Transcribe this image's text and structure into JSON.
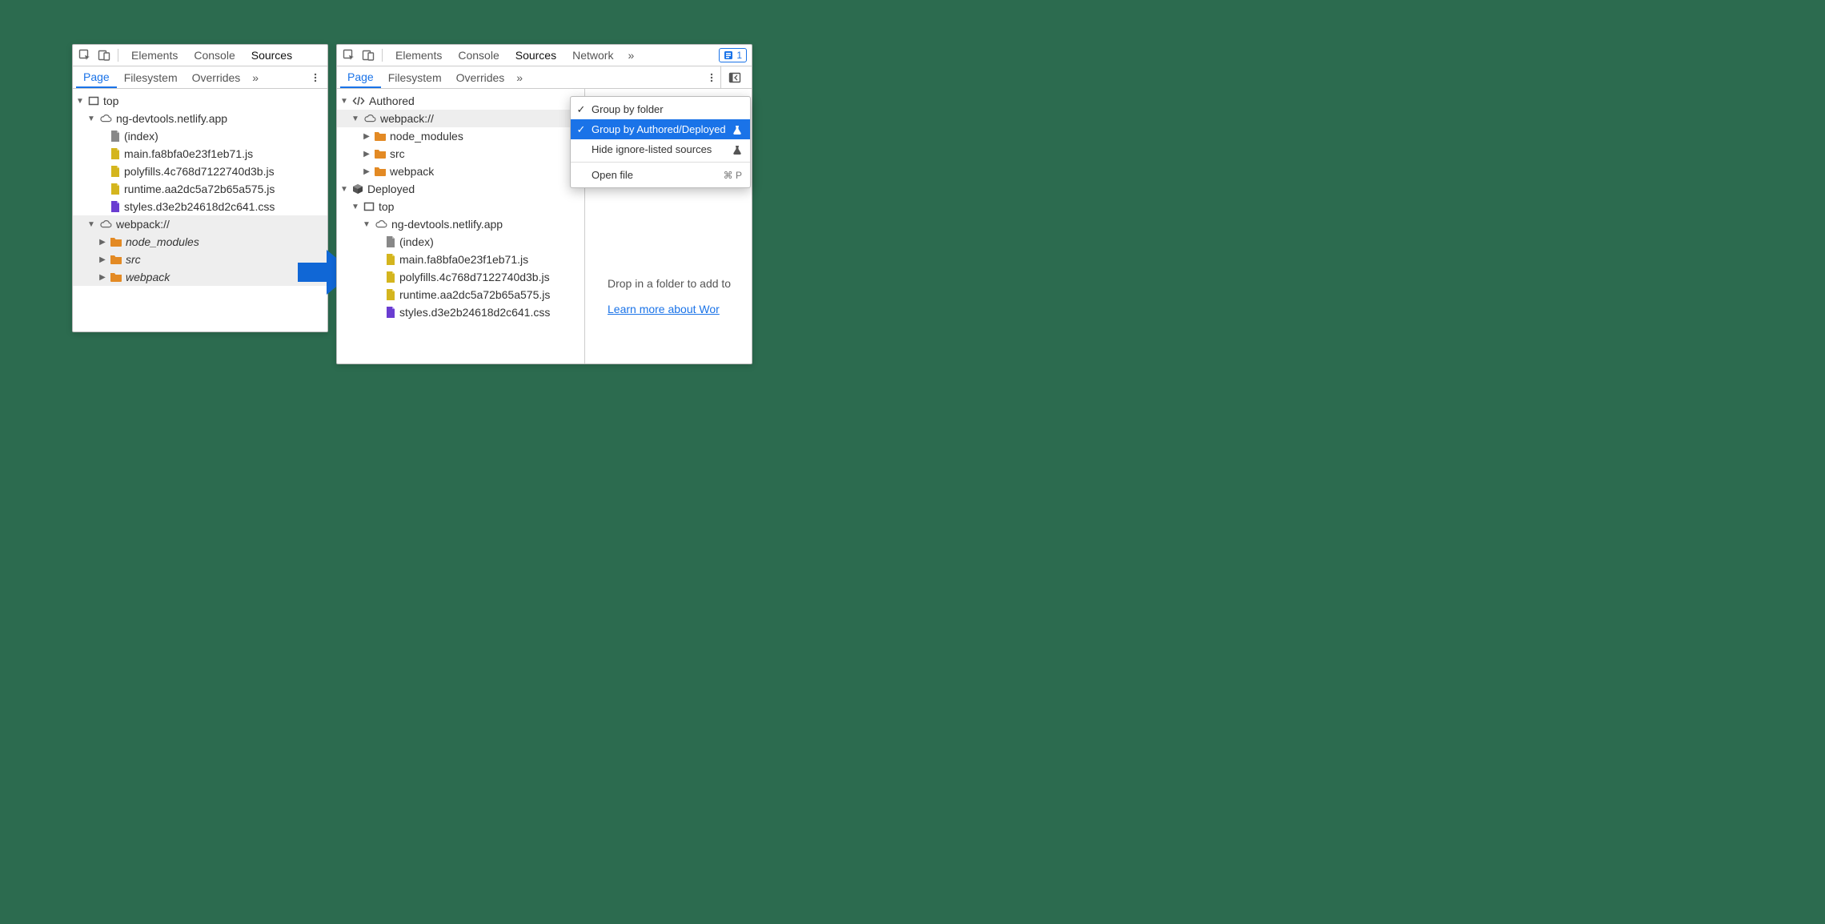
{
  "left": {
    "topTabs": [
      "Elements",
      "Console",
      "Sources"
    ],
    "activeTopTab": "Sources",
    "subTabs": [
      "Page",
      "Filesystem",
      "Overrides"
    ],
    "activeSubTab": "Page",
    "tree": {
      "top": "top",
      "domain": "ng-devtools.netlify.app",
      "files": [
        {
          "name": "(index)",
          "icon": "file-gray"
        },
        {
          "name": "main.fa8bfa0e23f1eb71.js",
          "icon": "file-js"
        },
        {
          "name": "polyfills.4c768d7122740d3b.js",
          "icon": "file-js"
        },
        {
          "name": "runtime.aa2dc5a72b65a575.js",
          "icon": "file-js"
        },
        {
          "name": "styles.d3e2b24618d2c641.css",
          "icon": "file-css"
        }
      ],
      "webpack": {
        "label": "webpack://",
        "folders": [
          "node_modules",
          "src",
          "webpack"
        ]
      }
    }
  },
  "right": {
    "topTabs": [
      "Elements",
      "Console",
      "Sources",
      "Network"
    ],
    "activeTopTab": "Sources",
    "issueCount": "1",
    "subTabs": [
      "Page",
      "Filesystem",
      "Overrides"
    ],
    "activeSubTab": "Page",
    "tree": {
      "authored": {
        "label": "Authored",
        "webpack": {
          "label": "webpack://",
          "folders": [
            "node_modules",
            "src",
            "webpack"
          ]
        }
      },
      "deployed": {
        "label": "Deployed",
        "top": "top",
        "domain": "ng-devtools.netlify.app",
        "files": [
          {
            "name": "(index)",
            "icon": "file-gray"
          },
          {
            "name": "main.fa8bfa0e23f1eb71.js",
            "icon": "file-js"
          },
          {
            "name": "polyfills.4c768d7122740d3b.js",
            "icon": "file-js"
          },
          {
            "name": "runtime.aa2dc5a72b65a575.js",
            "icon": "file-js"
          },
          {
            "name": "styles.d3e2b24618d2c641.css",
            "icon": "file-css"
          }
        ]
      }
    },
    "workspaceHint": {
      "text": "Drop in a folder to add to",
      "link": "Learn more about Wor"
    }
  },
  "menu": {
    "items": [
      {
        "label": "Group by folder",
        "checked": true,
        "experimental": false
      },
      {
        "label": "Group by Authored/Deployed",
        "checked": true,
        "selected": true,
        "experimental": true
      },
      {
        "label": "Hide ignore-listed sources",
        "checked": false,
        "experimental": true
      }
    ],
    "openFile": {
      "label": "Open file",
      "shortcut": "⌘ P"
    }
  }
}
